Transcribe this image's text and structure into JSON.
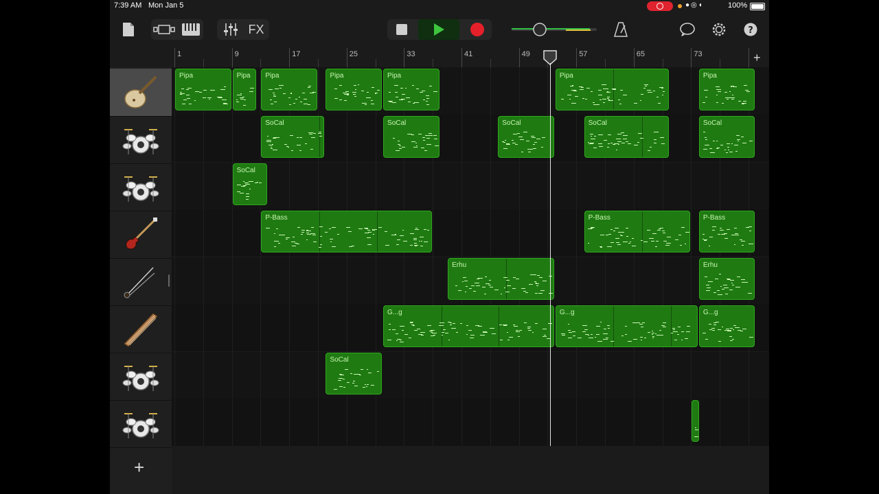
{
  "status_bar": {
    "time": "7:39 AM",
    "date": "Mon Jan 5",
    "battery": "100%"
  },
  "toolbar": {
    "fx_label": "FX"
  },
  "colors": {
    "region_fill": "#1f7a12",
    "region_border": "#2fa81c",
    "record": "#e6202a",
    "play": "#3ec53e"
  },
  "ruler": {
    "labels": [
      "1",
      "9",
      "17",
      "25",
      "33",
      "41",
      "49",
      "57",
      "65",
      "73"
    ]
  },
  "tracks": [
    {
      "instrument": "pipa-icon",
      "selected": true,
      "regions": [
        {
          "label": "Pipa",
          "start": 1,
          "end": 9
        },
        {
          "label": "Pipa",
          "start": 9,
          "end": 12.5
        },
        {
          "label": "Pipa",
          "start": 13,
          "end": 21
        },
        {
          "label": "Pipa",
          "start": 22,
          "end": 30
        },
        {
          "label": "Pipa",
          "start": 30,
          "end": 38
        },
        {
          "label": "Pipa",
          "start": 54,
          "end": 70
        },
        {
          "label": "Pipa",
          "start": 74,
          "end": 82
        }
      ]
    },
    {
      "instrument": "drum-kit-icon",
      "selected": false,
      "regions": [
        {
          "label": "SoCal",
          "start": 13,
          "end": 22
        },
        {
          "label": "SoCal",
          "start": 30,
          "end": 38
        },
        {
          "label": "SoCal",
          "start": 46,
          "end": 54
        },
        {
          "label": "SoCal",
          "start": 58,
          "end": 70
        },
        {
          "label": "SoCal",
          "start": 74,
          "end": 82
        }
      ]
    },
    {
      "instrument": "drum-kit-icon",
      "selected": false,
      "regions": [
        {
          "label": "SoCal",
          "start": 9,
          "end": 14
        }
      ]
    },
    {
      "instrument": "bass-guitar-icon",
      "selected": false,
      "regions": [
        {
          "label": "P-Bass",
          "start": 13,
          "end": 37
        },
        {
          "label": "P-Bass",
          "start": 58,
          "end": 73
        },
        {
          "label": "P-Bass",
          "start": 74,
          "end": 82
        }
      ]
    },
    {
      "instrument": "erhu-icon",
      "selected": false,
      "regions": [
        {
          "label": "Erhu",
          "start": 39,
          "end": 54
        },
        {
          "label": "Erhu",
          "start": 74,
          "end": 82
        }
      ]
    },
    {
      "instrument": "guzheng-icon",
      "selected": false,
      "regions": [
        {
          "label": "G...g",
          "start": 30,
          "end": 54
        },
        {
          "label": "G...g",
          "start": 54,
          "end": 74
        },
        {
          "label": "G...g",
          "start": 74,
          "end": 82
        }
      ]
    },
    {
      "instrument": "drum-kit-icon",
      "selected": false,
      "regions": [
        {
          "label": "SoCal",
          "start": 22,
          "end": 30
        }
      ]
    },
    {
      "instrument": "drum-kit-icon",
      "selected": false,
      "regions": [
        {
          "label": "",
          "start": 73,
          "end": 74.2
        }
      ]
    }
  ],
  "playhead_bar": 53.9
}
